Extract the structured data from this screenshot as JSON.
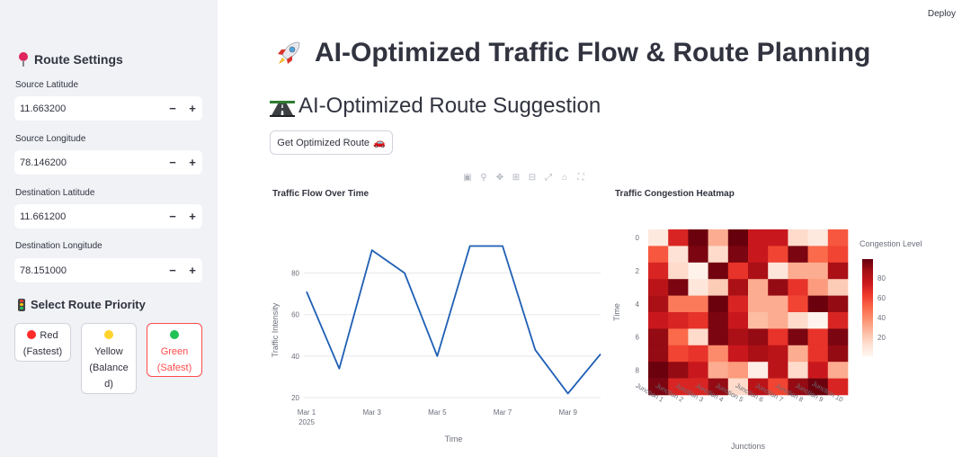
{
  "sidebar": {
    "title": "Route Settings",
    "fields": [
      {
        "label": "Source Latitude",
        "value": "11.663200"
      },
      {
        "label": "Source Longitude",
        "value": "78.146200"
      },
      {
        "label": "Destination Latitude",
        "value": "11.661200"
      },
      {
        "label": "Destination Longitude",
        "value": "78.151000"
      }
    ],
    "stepper_minus": "−",
    "stepper_plus": "+",
    "priority_title": "Select Route Priority",
    "priority_options": [
      {
        "line1": "Red",
        "line2": "(Fastest)",
        "color": "#ff2b2b"
      },
      {
        "line1": "Yellow",
        "line2": "(Balance",
        "line3": "d)",
        "color": "#ffd32b"
      },
      {
        "line1": "Green",
        "line2": "(Safest)",
        "color": "#21c354"
      }
    ],
    "selected_priority": "Green"
  },
  "header": {
    "deploy_label": "Deploy",
    "title": "AI-Optimized Traffic Flow & Route Planning",
    "subtitle": "AI-Optimized Route Suggestion",
    "button_label": "Get Optimized Route",
    "button_emoji": "🚗"
  },
  "charts": {
    "line_title": "Traffic Flow Over Time",
    "heatmap_title": "Traffic Congestion Heatmap"
  },
  "chart_data": [
    {
      "type": "line",
      "title": "Traffic Flow Over Time",
      "xlabel": "Time",
      "ylabel": "Traffic Intensity",
      "x": [
        "2025-03-01",
        "2025-03-02",
        "2025-03-03",
        "2025-03-04",
        "2025-03-05",
        "2025-03-06",
        "2025-03-07",
        "2025-03-08",
        "2025-03-09",
        "2025-03-10"
      ],
      "y": [
        71,
        34,
        91,
        80,
        40,
        93,
        93,
        43,
        22,
        41
      ],
      "xticks": [
        "Mar 1",
        "Mar 3",
        "Mar 5",
        "Mar 7",
        "Mar 9"
      ],
      "xtick_sub": "2025",
      "yticks": [
        20,
        40,
        60,
        80
      ],
      "ylim": [
        17,
        101
      ],
      "color": "#1f5fb4",
      "grid": true
    },
    {
      "type": "heatmap",
      "title": "Traffic Congestion Heatmap",
      "xlabel": "Junctions",
      "ylabel": "Time",
      "x": [
        "Junction 1",
        "Junction 2",
        "Junction 3",
        "Junction 4",
        "Junction 5",
        "Junction 6",
        "Junction 7",
        "Junction 8",
        "Junction 9",
        "Junction 10"
      ],
      "yticks": [
        "0",
        "2",
        "4",
        "6",
        "8"
      ],
      "colorbar_title": "Congestion Level",
      "colorbar_ticks": [
        20,
        40,
        60,
        80
      ],
      "zmin": 1,
      "zmax": 99,
      "z": [
        [
          8,
          70,
          98,
          30,
          99,
          75,
          75,
          15,
          8,
          55
        ],
        [
          55,
          12,
          95,
          15,
          95,
          75,
          60,
          95,
          50,
          60
        ],
        [
          70,
          15,
          3,
          97,
          65,
          85,
          10,
          30,
          30,
          85
        ],
        [
          80,
          95,
          10,
          20,
          85,
          30,
          90,
          65,
          35,
          20
        ],
        [
          85,
          45,
          45,
          98,
          70,
          30,
          30,
          60,
          98,
          90
        ],
        [
          75,
          70,
          65,
          95,
          75,
          25,
          30,
          15,
          2,
          70
        ],
        [
          90,
          50,
          15,
          95,
          85,
          90,
          65,
          95,
          65,
          95
        ],
        [
          90,
          60,
          65,
          40,
          75,
          85,
          80,
          30,
          65,
          90
        ],
        [
          98,
          90,
          75,
          30,
          35,
          5,
          80,
          15,
          75,
          30
        ],
        [
          95,
          70,
          70,
          90,
          15,
          80,
          60,
          90,
          98,
          70
        ]
      ]
    }
  ]
}
